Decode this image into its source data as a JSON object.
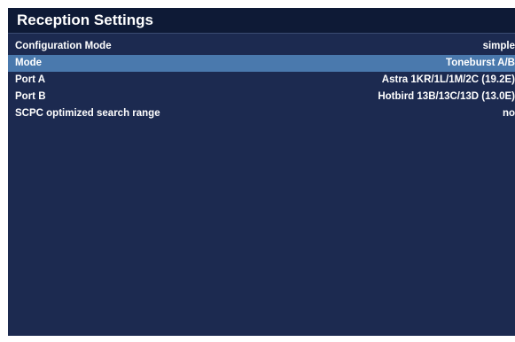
{
  "window": {
    "title": "Reception Settings"
  },
  "settings": [
    {
      "label": "Configuration Mode",
      "value": "simple",
      "selected": false
    },
    {
      "label": "Mode",
      "value": "Toneburst A/B",
      "selected": true
    },
    {
      "label": "Port A",
      "value": "Astra 1KR/1L/1M/2C (19.2E)",
      "selected": false
    },
    {
      "label": "Port B",
      "value": "Hotbird 13B/13C/13D (13.0E)",
      "selected": false
    },
    {
      "label": "SCPC optimized search range",
      "value": "no",
      "selected": false
    }
  ],
  "colors": {
    "window_background": "#1c2a50",
    "title_bar": "#0e1a36",
    "selection_highlight": "#4a79ad",
    "text": "#ffffff"
  }
}
